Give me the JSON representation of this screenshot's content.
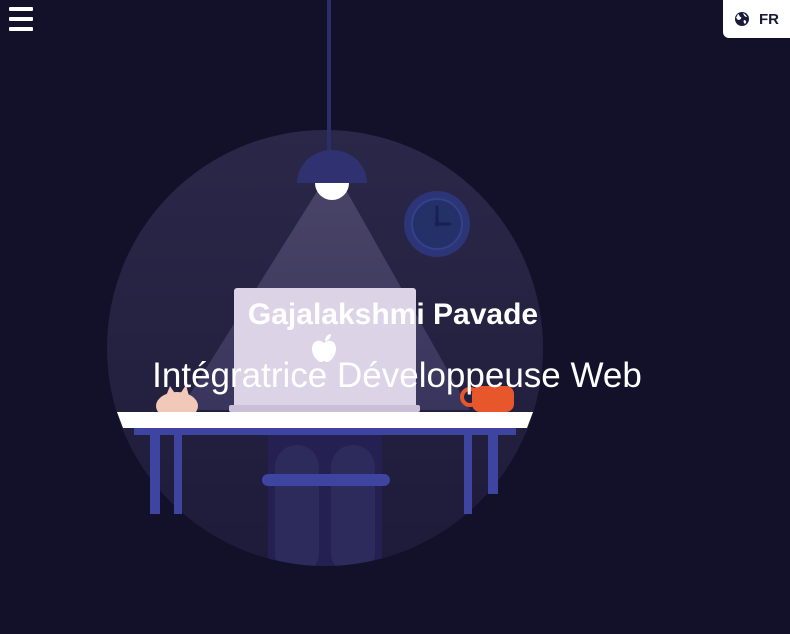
{
  "header": {
    "menu_icon": "hamburger-menu-icon",
    "language": {
      "label": "FR",
      "icon": "globe-icon"
    }
  },
  "hero": {
    "name": "Gajalakshmi Pavade",
    "role": "Intégratrice Développeuse Web"
  },
  "illustration": {
    "icons": [
      "pendant-lamp",
      "wall-clock-icon",
      "laptop-icon",
      "apple-logo-icon",
      "coffee-cup-icon",
      "cat-icon",
      "desk",
      "chair"
    ]
  },
  "colors": {
    "background": "#13112a",
    "circle": "#2a2748",
    "light_cone": "#3e3a5e",
    "desk_top": "#ffffff",
    "desk_legs": "#3d45a0",
    "laptop": "#dcd3e6",
    "mug": "#e8572c",
    "lamp_shade": "#2f3170",
    "clock": "#2c3577"
  }
}
